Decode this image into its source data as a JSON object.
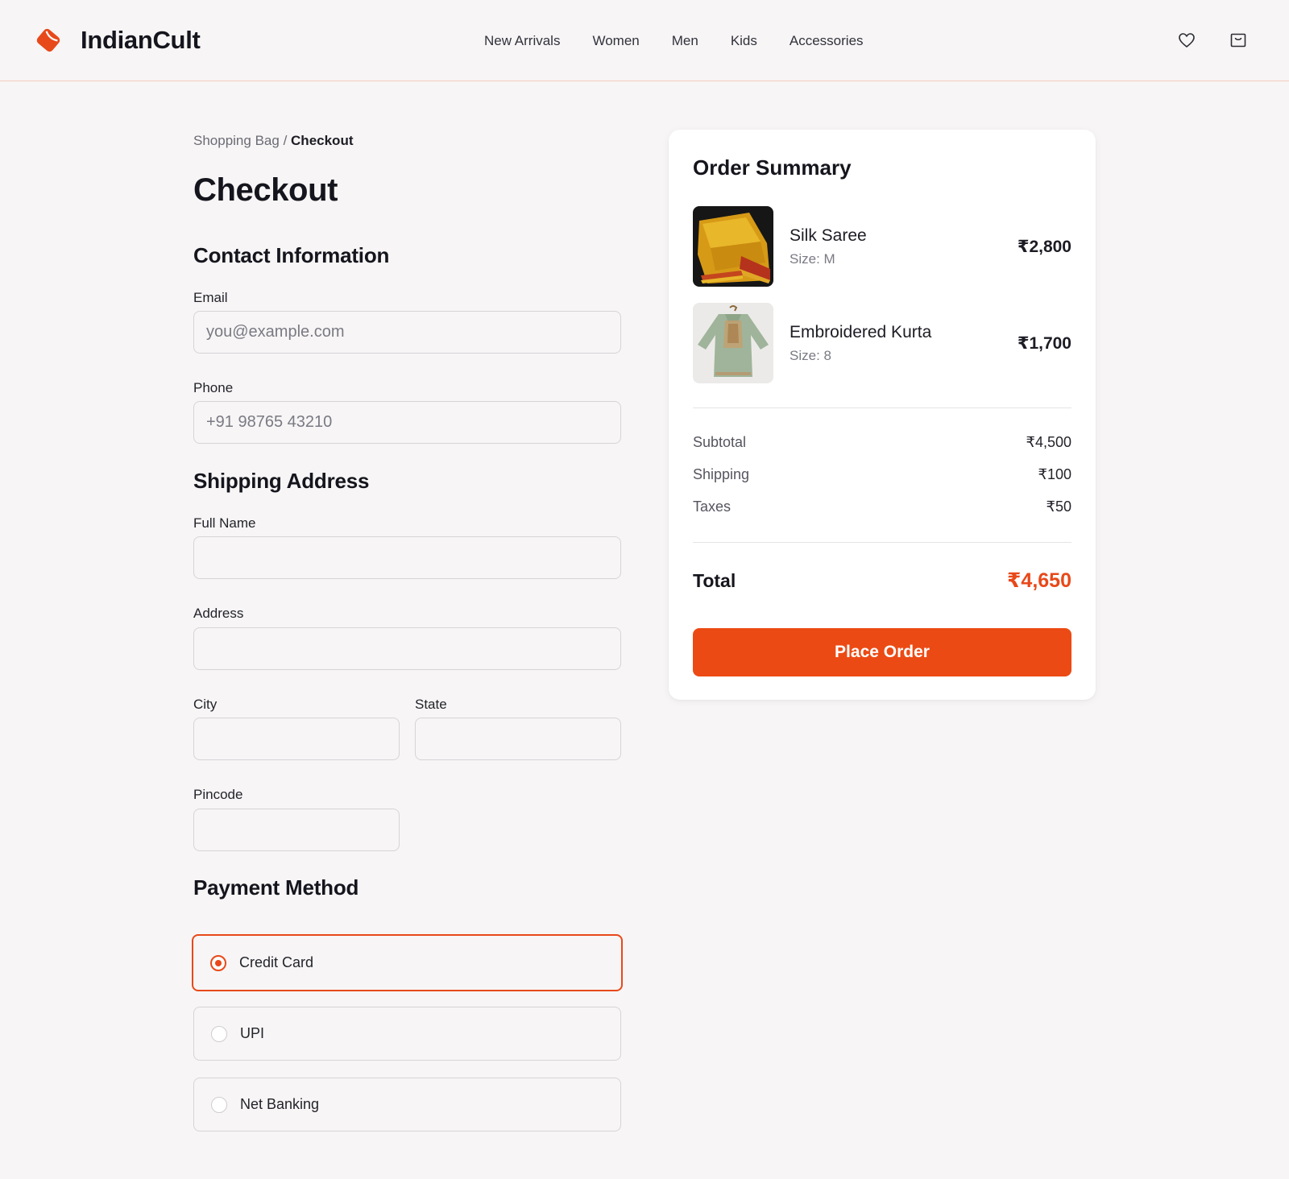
{
  "brand": {
    "name": "IndianCult",
    "accent": "#ec4a14"
  },
  "nav": {
    "items": [
      "New Arrivals",
      "Women",
      "Men",
      "Kids",
      "Accessories"
    ]
  },
  "header_icons": [
    "heart-icon",
    "shopping-bag-icon"
  ],
  "breadcrumb": {
    "parent": "Shopping Bag",
    "separator": "/",
    "current": "Checkout"
  },
  "page_title": "Checkout",
  "contact": {
    "title": "Contact Information",
    "email_label": "Email",
    "email_placeholder": "you@example.com",
    "phone_label": "Phone",
    "phone_placeholder": "+91 98765 43210"
  },
  "shipping": {
    "title": "Shipping Address",
    "full_name_label": "Full Name",
    "address_label": "Address",
    "city_label": "City",
    "state_label": "State",
    "pincode_label": "Pincode"
  },
  "payment": {
    "title": "Payment Method",
    "options": [
      {
        "label": "Credit Card",
        "selected": true
      },
      {
        "label": "UPI",
        "selected": false
      },
      {
        "label": "Net Banking",
        "selected": false
      }
    ]
  },
  "summary": {
    "title": "Order Summary",
    "items": [
      {
        "name": "Silk Saree",
        "size": "Size: M",
        "price": "₹2,800",
        "image": "silk-saree-image"
      },
      {
        "name": "Embroidered Kurta",
        "size": "Size: 8",
        "price": "₹1,700",
        "image": "embroidered-kurta-image"
      }
    ],
    "subtotal_label": "Subtotal",
    "subtotal": "₹4,500",
    "shipping_label": "Shipping",
    "shipping": "₹100",
    "taxes_label": "Taxes",
    "taxes": "₹50",
    "total_label": "Total",
    "total": "₹4,650",
    "cta": "Place Order"
  }
}
